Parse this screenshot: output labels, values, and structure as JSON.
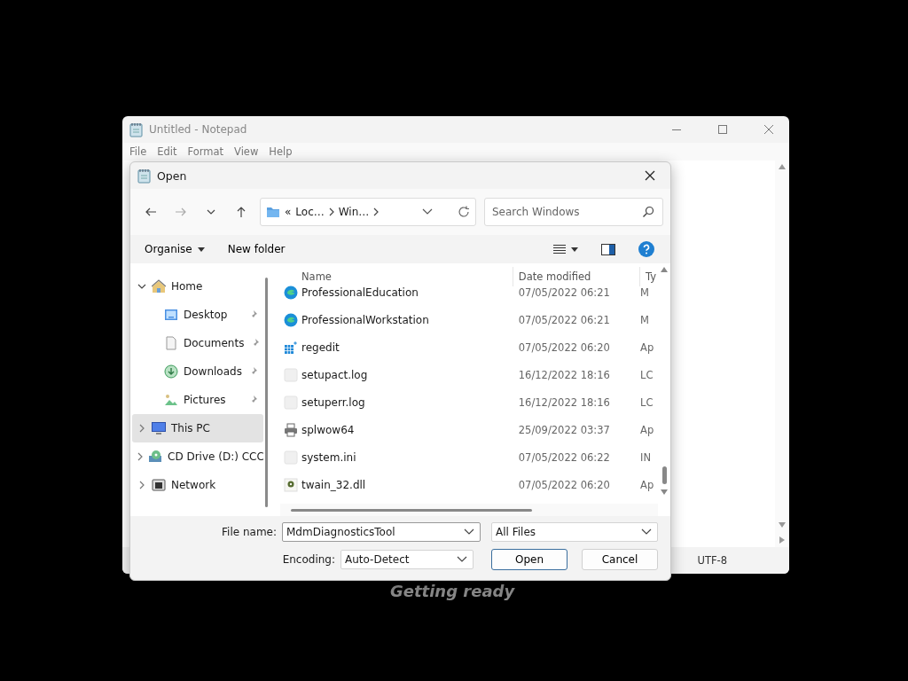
{
  "background_text": "Getting ready",
  "notepad": {
    "title": "Untitled - Notepad",
    "menu": [
      "File",
      "Edit",
      "Format",
      "View",
      "Help"
    ],
    "status_bar": [
      "UTF-8"
    ]
  },
  "dialog": {
    "title": "Open",
    "address": {
      "overflow": "«",
      "crumbs": [
        "Loc…",
        "Win…"
      ]
    },
    "search": {
      "placeholder": "Search Windows"
    },
    "toolbar": {
      "organise": "Organise",
      "new_folder": "New folder"
    },
    "sidebar": [
      {
        "label": "Home",
        "kind": "home",
        "expanded": true,
        "selected": false,
        "children": [
          {
            "label": "Desktop",
            "kind": "desktop",
            "pinned": true,
            "selected": false
          },
          {
            "label": "Documents",
            "kind": "documents",
            "pinned": true,
            "selected": false
          },
          {
            "label": "Downloads",
            "kind": "downloads",
            "pinned": true,
            "selected": false
          },
          {
            "label": "Pictures",
            "kind": "pictures",
            "pinned": true,
            "selected": false
          }
        ]
      },
      {
        "label": "This PC",
        "kind": "pc",
        "expanded": false,
        "selected": true
      },
      {
        "label": "CD Drive (D:) CCC",
        "kind": "cd",
        "expanded": false,
        "selected": false
      },
      {
        "label": "Network",
        "kind": "network",
        "expanded": false,
        "selected": false
      }
    ],
    "columns": [
      "Name",
      "Date modified",
      "Ty"
    ],
    "files": [
      {
        "name": "ProfessionalEducation",
        "date": "07/05/2022 06:21",
        "type": "M",
        "kind": "edge"
      },
      {
        "name": "ProfessionalWorkstation",
        "date": "07/05/2022 06:21",
        "type": "M",
        "kind": "edge"
      },
      {
        "name": "regedit",
        "date": "07/05/2022 06:20",
        "type": "Ap",
        "kind": "registry"
      },
      {
        "name": "setupact.log",
        "date": "16/12/2022 18:16",
        "type": "LC",
        "kind": "blank"
      },
      {
        "name": "setuperr.log",
        "date": "16/12/2022 18:16",
        "type": "LC",
        "kind": "blank"
      },
      {
        "name": "splwow64",
        "date": "25/09/2022 03:37",
        "type": "Ap",
        "kind": "printer"
      },
      {
        "name": "system.ini",
        "date": "07/05/2022 06:22",
        "type": "IN",
        "kind": "blank"
      },
      {
        "name": "twain_32.dll",
        "date": "07/05/2022 06:20",
        "type": "Ap",
        "kind": "dll"
      }
    ],
    "file_name": {
      "label": "File name:",
      "value": "MdmDiagnosticsTool"
    },
    "filter": "All Files",
    "encoding": {
      "label": "Encoding:",
      "value": "Auto-Detect"
    },
    "buttons": [
      {
        "label": "Open",
        "default": true
      },
      {
        "label": "Cancel",
        "default": false
      }
    ]
  }
}
